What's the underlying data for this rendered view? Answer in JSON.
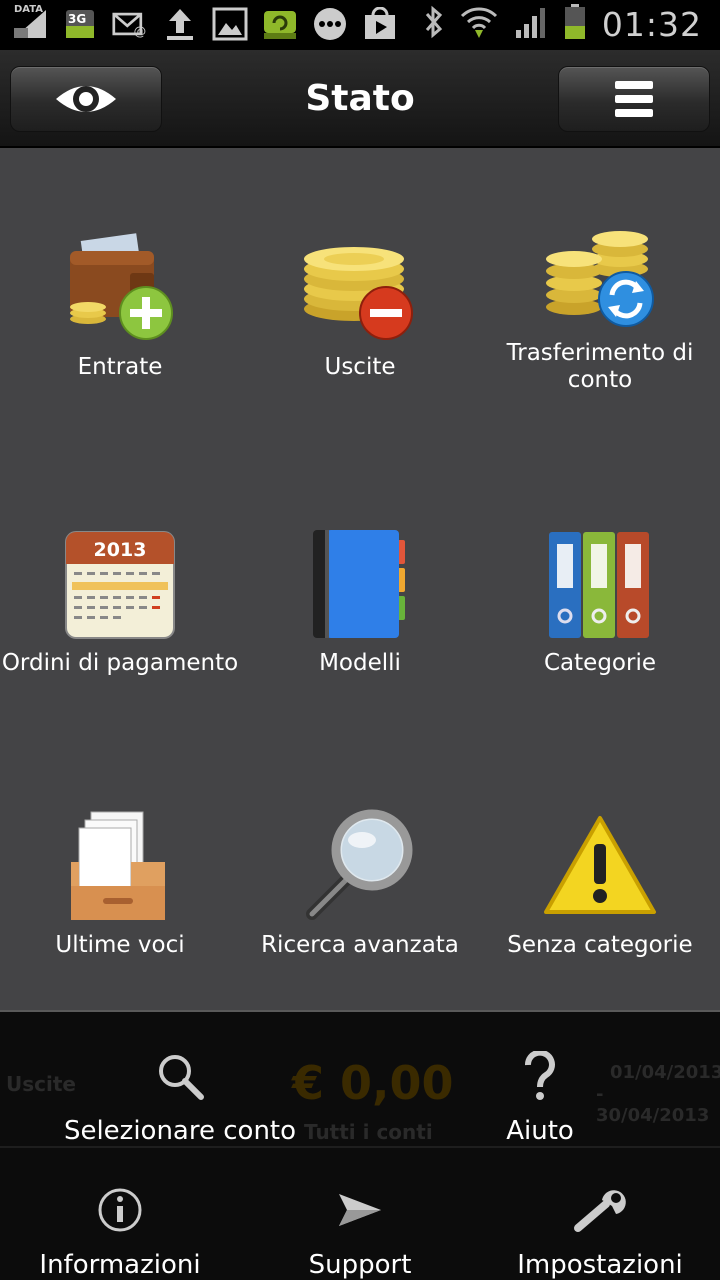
{
  "status_bar": {
    "data_label": "DATA",
    "network_label": "3G",
    "time": "01:32"
  },
  "action_bar": {
    "title": "Stato",
    "left_icon": "eye-icon",
    "right_icon": "menu-icon"
  },
  "grid": {
    "items": [
      {
        "label": "Entrate",
        "icon": "wallet-add-icon"
      },
      {
        "label": "Uscite",
        "icon": "coins-remove-icon"
      },
      {
        "label": "Trasferimento di conto",
        "icon": "coins-transfer-icon"
      },
      {
        "label": "Ordini di pagamento",
        "icon": "calendar-icon",
        "calendar_year": "2013"
      },
      {
        "label": "Modelli",
        "icon": "notebook-icon"
      },
      {
        "label": "Categorie",
        "icon": "binders-icon"
      },
      {
        "label": "Ultime voci",
        "icon": "inbox-tray-icon"
      },
      {
        "label": "Ricerca avanzata",
        "icon": "magnifier-icon"
      },
      {
        "label": "Senza categorie",
        "icon": "warning-icon"
      }
    ]
  },
  "background_panel": {
    "label": "Uscite",
    "amount": "€ 0,00",
    "account": "Tutti i conti",
    "date_from": "01/04/2013",
    "date_to": "- 30/04/2013"
  },
  "menu": {
    "row1": [
      {
        "label": "Selezionare conto",
        "icon": "search-icon"
      },
      {
        "label": "Aiuto",
        "icon": "help-icon"
      }
    ],
    "row2": [
      {
        "label": "Informazioni",
        "icon": "info-icon"
      },
      {
        "label": "Support",
        "icon": "send-icon"
      },
      {
        "label": "Impostazioni",
        "icon": "wrench-icon"
      }
    ]
  },
  "colors": {
    "grid_bg": "#444446",
    "action_bar": "#1c1c1c",
    "ghost_amount": "#3a2a00"
  }
}
